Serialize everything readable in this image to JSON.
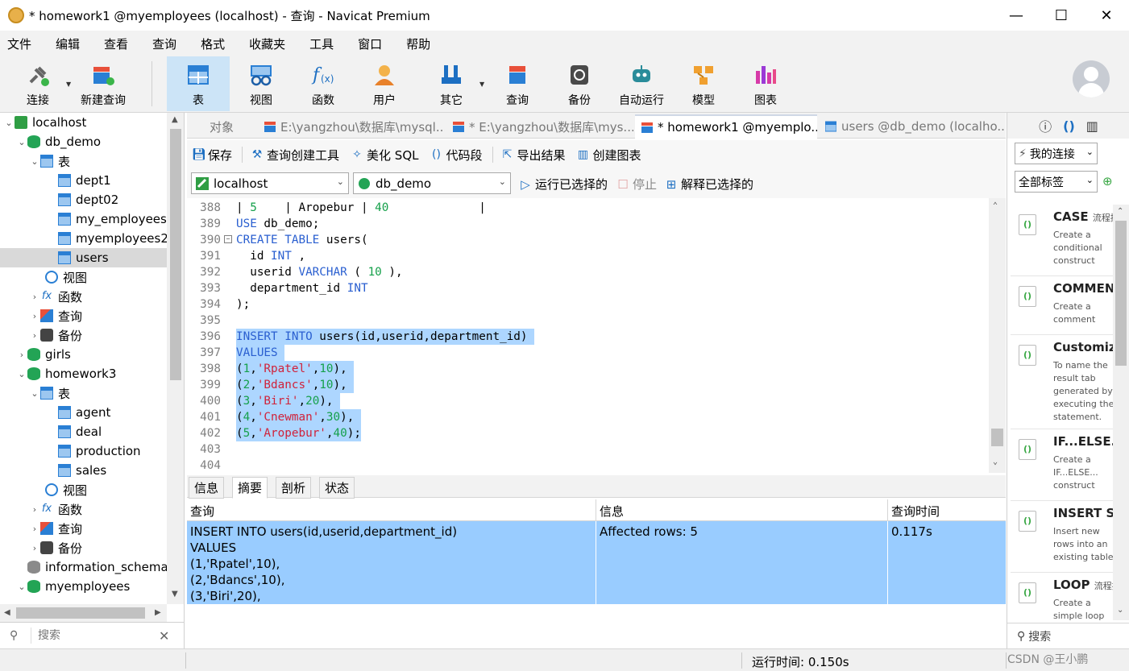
{
  "window": {
    "title": "* homework1 @myemployees (localhost) - 查询 - Navicat Premium",
    "minimize": "—",
    "maximize": "☐",
    "close": "✕"
  },
  "menu": [
    "文件",
    "编辑",
    "查看",
    "查询",
    "格式",
    "收藏夹",
    "工具",
    "窗口",
    "帮助"
  ],
  "toolbar": {
    "connect": "连接",
    "new_query": "新建查询",
    "table": "表",
    "view": "视图",
    "function": "函数",
    "user": "用户",
    "other": "其它",
    "query": "查询",
    "backup": "备份",
    "auto_run": "自动运行",
    "model": "模型",
    "chart": "图表"
  },
  "tree": {
    "localhost": "localhost",
    "db_demo": "db_demo",
    "tables": "表",
    "dept1": "dept1",
    "dept02": "dept02",
    "my_employees": "my_employees",
    "myemployees2": "myemployees2",
    "users": "users",
    "views": "视图",
    "functions": "函数",
    "queries": "查询",
    "backups": "备份",
    "girls": "girls",
    "homework3": "homework3",
    "tables2": "表",
    "agent": "agent",
    "deal": "deal",
    "production": "production",
    "sales": "sales",
    "views2": "视图",
    "functions2": "函数",
    "queries2": "查询",
    "backups2": "备份",
    "information_schema": "information_schema",
    "myemployees": "myemployees",
    "search_placeholder": "搜索"
  },
  "tabs": {
    "objects": "对象",
    "tab2": "E:\\yangzhou\\数据库\\mysql...",
    "tab3": "* E:\\yangzhou\\数据库\\mys...",
    "tab4": "* homework1 @myemplo...",
    "tab5": "users @db_demo (localho..."
  },
  "editor_toolbar": {
    "save": "保存",
    "query_builder": "查询创建工具",
    "beautify": "美化 SQL",
    "snippet": "代码段",
    "export": "导出结果",
    "create_chart": "创建图表"
  },
  "conn_bar": {
    "connection": "localhost",
    "database": "db_demo",
    "run_selected": "运行已选择的",
    "stop": "停止",
    "explain": "解释已选择的"
  },
  "code": {
    "ln388": "388",
    "ln389": "389",
    "ln390": "390",
    "ln391": "391",
    "ln392": "392",
    "ln393": "393",
    "ln394": "394",
    "ln395": "395",
    "ln396": "396",
    "ln397": "397",
    "ln398": "398",
    "ln399": "399",
    "ln400": "400",
    "ln401": "401",
    "ln402": "402",
    "ln403": "403",
    "ln404": "404"
  },
  "result_tabs": [
    "信息",
    "摘要",
    "剖析",
    "状态"
  ],
  "result_grid": {
    "headers": [
      "查询",
      "信息",
      "查询时间"
    ],
    "query_lines": [
      "INSERT INTO users(id,userid,department_id)",
      "VALUES",
      "(1,'Rpatel',10),",
      "(2,'Bdancs',10),",
      "(3,'Biri',20),"
    ],
    "info": "Affected rows: 5",
    "time": "0.117s"
  },
  "right_panel": {
    "my_connections": "我的连接",
    "all_tags": "全部标签",
    "search": "搜索",
    "snippets": [
      {
        "title": "CASE",
        "tag": "流程控",
        "desc": "Create a conditional construct"
      },
      {
        "title": "COMMEN",
        "tag": "",
        "desc": "Create a comment"
      },
      {
        "title": "Customiz",
        "tag": "",
        "desc": "To name the result tab generated by executing the statement."
      },
      {
        "title": "IF...ELSE...",
        "tag": "",
        "desc": "Create a IF...ELSE... construct"
      },
      {
        "title": "INSERT Sy",
        "tag": "",
        "desc": "Insert new rows into an existing table"
      },
      {
        "title": "LOOP",
        "tag": "流程控",
        "desc": "Create a simple loop"
      }
    ]
  },
  "status": {
    "run_time": "运行时间: 0.150s",
    "watermark": "CSDN @王小鹏"
  }
}
